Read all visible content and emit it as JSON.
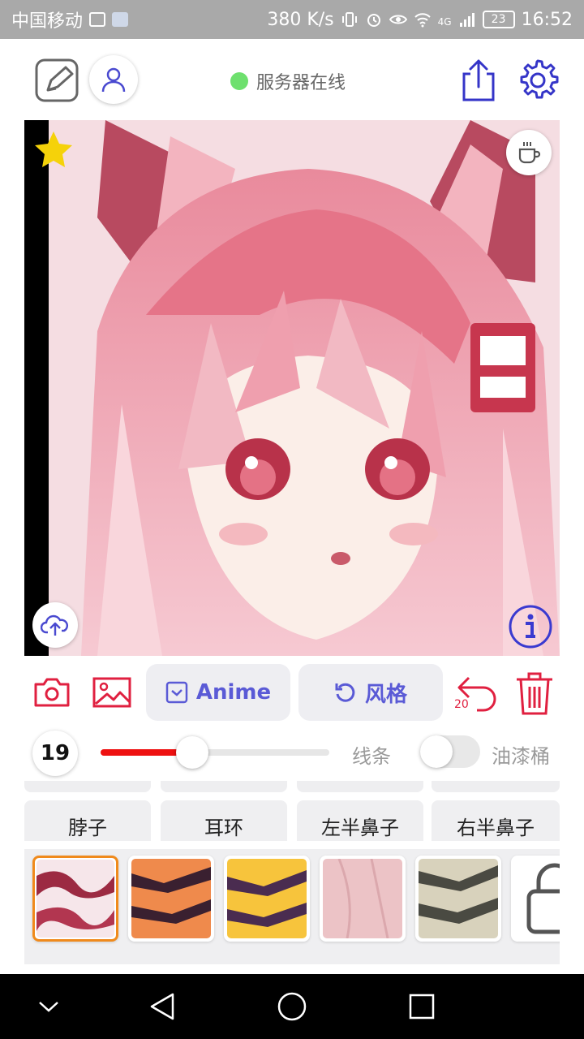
{
  "status_bar": {
    "carrier": "中国移动",
    "speed": "380 K/s",
    "network": "4G",
    "battery": "23",
    "time": "16:52"
  },
  "top_bar": {
    "server_status": "服务器在线",
    "server_status_color": "#6ee06e"
  },
  "tool_row": {
    "anime_label": "Anime",
    "style_label": "风格",
    "undo_count": "20",
    "accent_color": "#e02040",
    "pill_text_color": "#5a5ad6"
  },
  "slider_row": {
    "brush_size": "19",
    "slider_fraction": 0.4,
    "line_label": "线条",
    "bucket_label": "油漆桶",
    "bucket_toggle_on": false
  },
  "parts": [
    "脖子",
    "耳环",
    "左半鼻子",
    "右半鼻子"
  ],
  "textures": [
    {
      "name": "pink-white-stripes",
      "selected": true
    },
    {
      "name": "orange-tiger-stripes",
      "selected": false
    },
    {
      "name": "yellow-tiger-stripes",
      "selected": false
    },
    {
      "name": "pink-smooth",
      "selected": false
    },
    {
      "name": "gray-zebra-stripes",
      "selected": false
    },
    {
      "name": "lock-icon",
      "selected": false
    }
  ],
  "icons": [
    "edit-icon",
    "user-icon",
    "share-icon",
    "gear-icon",
    "star-icon",
    "coffee-cup-icon",
    "cloud-upload-icon",
    "info-icon",
    "camera-icon",
    "image-icon",
    "checkbox-icon",
    "rotate-icon",
    "undo-icon",
    "trash-icon",
    "back-icon",
    "home-icon",
    "recents-icon"
  ]
}
